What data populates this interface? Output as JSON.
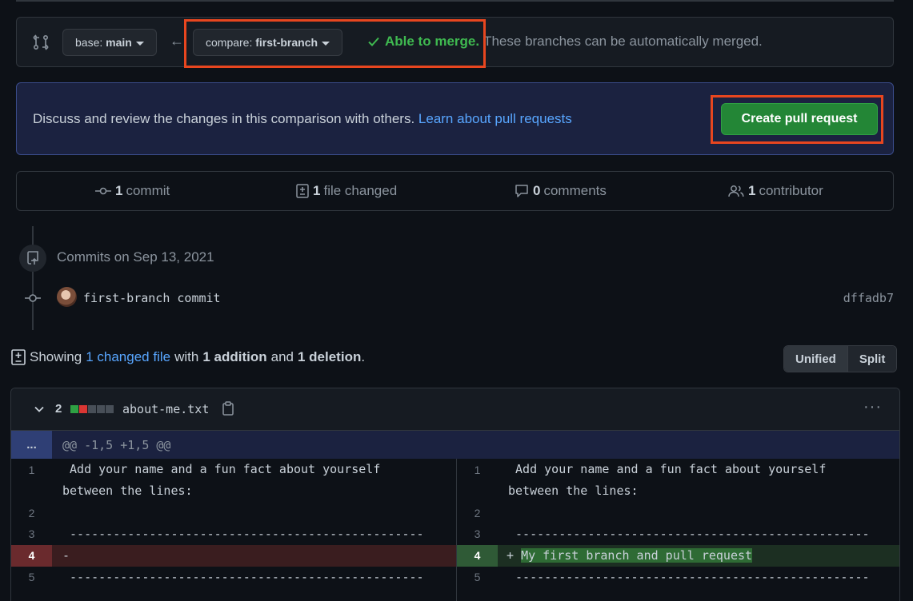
{
  "compare_bar": {
    "base_label": "base:",
    "base_value": "main",
    "compare_label": "compare:",
    "compare_value": "first-branch",
    "merge_ok": "Able to merge.",
    "merge_text": "These branches can be automatically merged."
  },
  "banner": {
    "text": "Discuss and review the changes in this comparison with others.",
    "link": "Learn about pull requests",
    "create_button": "Create pull request"
  },
  "stats": {
    "commits_count": "1",
    "commits_label": "commit",
    "files_count": "1",
    "files_label": "file changed",
    "comments_count": "0",
    "comments_label": "comments",
    "contributors_count": "1",
    "contributors_label": "contributor"
  },
  "commits": {
    "date_heading": "Commits on Sep 13, 2021",
    "items": [
      {
        "message": "first-branch commit",
        "sha": "dffadb7"
      }
    ]
  },
  "showing": {
    "prefix": "Showing",
    "changed_link": "1 changed file",
    "with": "with",
    "additions": "1 addition",
    "and": "and",
    "deletions": "1 deletion",
    "suffix": "."
  },
  "view_toggle": {
    "unified": "Unified",
    "split": "Split",
    "selected": "Unified"
  },
  "file": {
    "change_count": "2",
    "name": "about-me.txt",
    "hunk_expand": "...",
    "hunk_header": "@@ -1,5 +1,5 @@",
    "kebab": "···",
    "left": [
      {
        "num": "1",
        "text": " Add your name and a fun fact about yourself\nbetween the lines:"
      },
      {
        "num": "2",
        "text": ""
      },
      {
        "num": "3",
        "text": " -------------------------------------------------"
      },
      {
        "num": "4",
        "text": "-"
      },
      {
        "num": "5",
        "text": " -------------------------------------------------"
      }
    ],
    "right": [
      {
        "num": "1",
        "text": " Add your name and a fun fact about yourself\nbetween the lines:"
      },
      {
        "num": "2",
        "text": ""
      },
      {
        "num": "3",
        "text": " -------------------------------------------------"
      },
      {
        "num": "4",
        "marker": "+",
        "text": "My first branch and pull request"
      },
      {
        "num": "5",
        "text": " -------------------------------------------------"
      }
    ]
  },
  "colors": {
    "background": "#0d1117",
    "accent_green": "#238636",
    "merge_green": "#3fb950",
    "link_blue": "#58a6ff",
    "highlight_box": "#e8461f"
  }
}
